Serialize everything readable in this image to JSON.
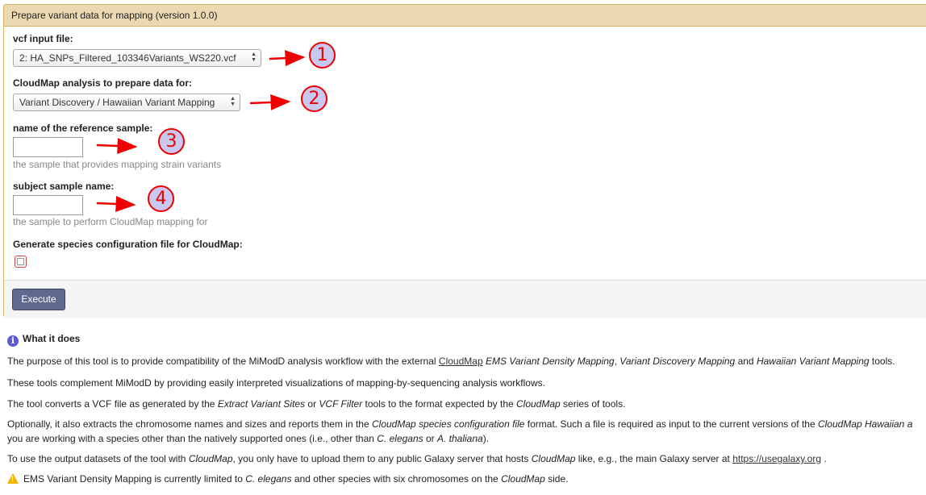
{
  "tool": {
    "title": "Prepare variant data for mapping (version 1.0.0)",
    "vcf_label": "vcf input file:",
    "vcf_value": "2: HA_SNPs_Filtered_103346Variants_WS220.vcf",
    "analysis_label": "CloudMap analysis to prepare data for:",
    "analysis_value": "Variant Discovery / Hawaiian Variant Mapping",
    "ref_label": "name of the reference sample:",
    "ref_value": "",
    "ref_help": "the sample that provides mapping strain variants",
    "subject_label": "subject sample name:",
    "subject_value": "",
    "subject_help": "the sample to perform CloudMap mapping for",
    "species_label": "Generate species configuration file for CloudMap:",
    "species_checked": false,
    "execute_label": "Execute"
  },
  "annotations": [
    "1",
    "2",
    "3",
    "4"
  ],
  "help": {
    "heading": "What it does",
    "p1_a": "The purpose of this tool is to provide compatibility of the MiModD analysis workflow with the external ",
    "p1_link": "CloudMap",
    "p1_b": " ",
    "p1_i1": "EMS Variant Density Mapping",
    "p1_c": ", ",
    "p1_i2": "Variant Discovery Mapping",
    "p1_d": " and ",
    "p1_i3": "Hawaiian Variant Mapping",
    "p1_e": " tools.",
    "p2": "These tools complement MiModD by providing easily interpreted visualizations of mapping-by-sequencing analysis workflows.",
    "p3_a": "The tool converts a VCF file as generated by the ",
    "p3_i1": "Extract Variant Sites",
    "p3_b": " or ",
    "p3_i2": "VCF Filter",
    "p3_c": " tools to the format expected by the ",
    "p3_i3": "CloudMap",
    "p3_d": " series of tools.",
    "p4_a": "Optionally, it also extracts the chromosome names and sizes and reports them in the ",
    "p4_i1": "CloudMap species configuration file",
    "p4_b": " format. Such a file is required as input to the current versions of the ",
    "p4_i2": "CloudMap Hawaiian a",
    "p4_line2_a": "you are working with a species other than the natively supported ones (i.e., other than ",
    "p4_line2_i1": "C. elegans",
    "p4_line2_b": " or ",
    "p4_line2_i2": "A. thaliana",
    "p4_line2_c": ").",
    "p5_a": "To use the output datasets of the tool with ",
    "p5_i1": "CloudMap",
    "p5_b": ", you only have to upload them to any public Galaxy server that hosts ",
    "p5_i2": "CloudMap",
    "p5_c": " like, e.g., the main Galaxy server at ",
    "p5_link": "https://usegalaxy.org",
    "p5_d": " .",
    "p6_a": "EMS Variant Density Mapping is currently limited to ",
    "p6_i1": "C. elegans",
    "p6_b": " and other species with six chromosomes on the ",
    "p6_i2": "CloudMap",
    "p6_c": " side."
  },
  "colors": {
    "accent_border": "#d8b365",
    "title_bg": "#ebd9b2",
    "execute_bg": "#5f6990",
    "annotation_red": "#e00000",
    "annotation_fill": "#c8c8f0"
  }
}
